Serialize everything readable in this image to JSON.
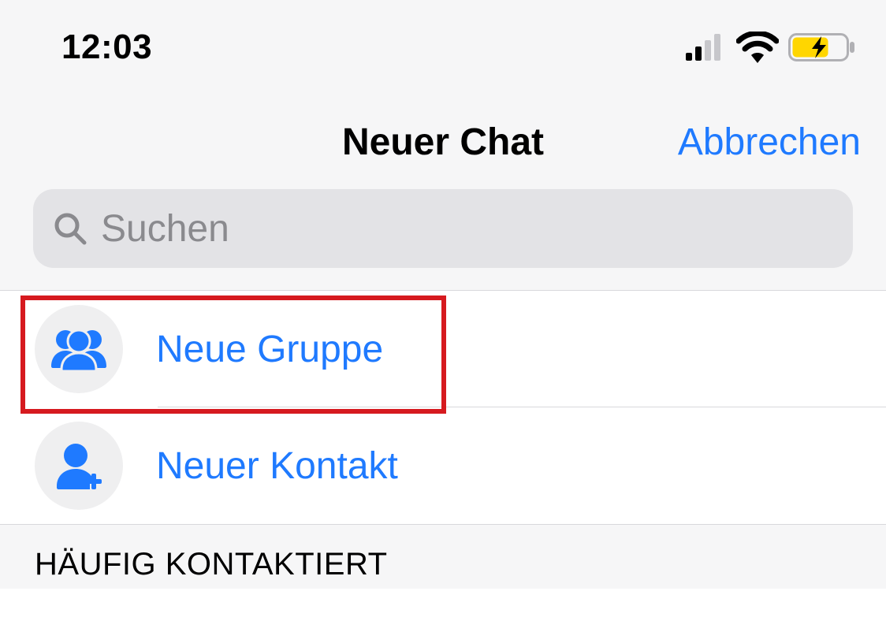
{
  "status_bar": {
    "time": "12:03"
  },
  "nav": {
    "title": "Neuer Chat",
    "cancel": "Abbrechen"
  },
  "search": {
    "placeholder": "Suchen"
  },
  "actions": {
    "new_group": "Neue Gruppe",
    "new_contact": "Neuer Kontakt"
  },
  "section": {
    "frequent": "HÄUFIG KONTAKTIERT"
  },
  "colors": {
    "accent": "#1f7aff",
    "highlight": "#d61a1f",
    "battery_fill": "#ffd600"
  }
}
